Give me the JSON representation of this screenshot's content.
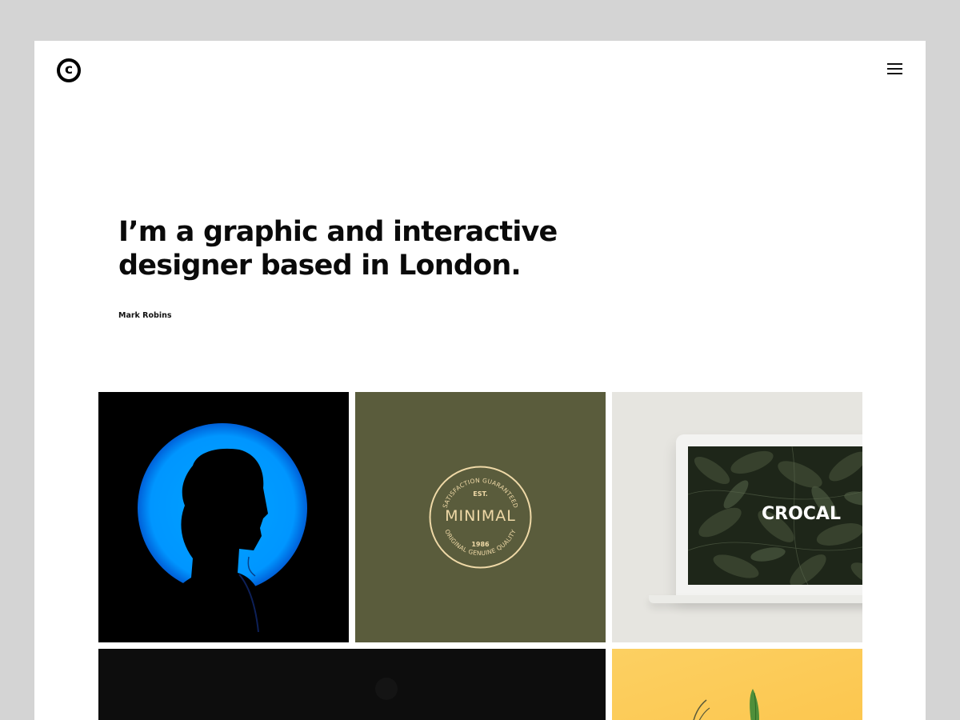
{
  "header": {
    "logo_glyph": "c",
    "logo_icon": "copyright-icon",
    "menu_icon": "hamburger-menu-icon"
  },
  "hero": {
    "line1": "I’m a graphic and interactive",
    "line2": "designer based in London.",
    "author": "Mark Robins"
  },
  "portfolio": {
    "tiles": [
      {
        "name": "portrait-silhouette",
        "background": "#000000",
        "accent": "#0098ff"
      },
      {
        "name": "minimal-badge",
        "background": "#5a5c3c",
        "accent": "#efd9a7",
        "badge": {
          "top_arc": "SATISFACTION GUARANTEED",
          "est": "EST.",
          "title": "MINIMAL",
          "year": "1986",
          "bottom_arc": "ORIGINAL GENUINE QUALITY"
        }
      },
      {
        "name": "crocal-laptop",
        "background": "#e6e5e0",
        "screen_text": "CROCAL"
      },
      {
        "name": "dark-project",
        "background": "#0d0d0d"
      },
      {
        "name": "yellow-plant",
        "background": "#fccb57"
      }
    ]
  }
}
